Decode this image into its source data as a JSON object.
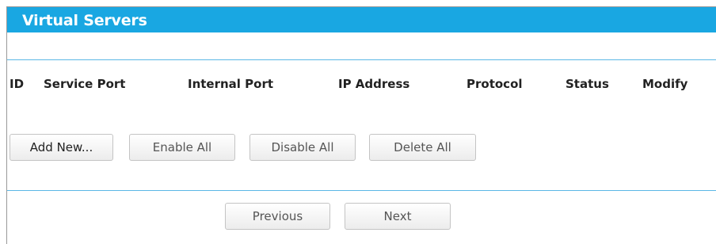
{
  "page": {
    "title": "Virtual Servers"
  },
  "table": {
    "columns": [
      "ID",
      "Service Port",
      "Internal Port",
      "IP Address",
      "Protocol",
      "Status",
      "Modify"
    ],
    "rows": []
  },
  "actions": {
    "add_new": "Add New...",
    "enable_all": "Enable All",
    "disable_all": "Disable All",
    "delete_all": "Delete All"
  },
  "pagination": {
    "previous": "Previous",
    "next": "Next"
  },
  "colors": {
    "header_bg": "#19a7e2",
    "divider": "#5bb8e6"
  }
}
